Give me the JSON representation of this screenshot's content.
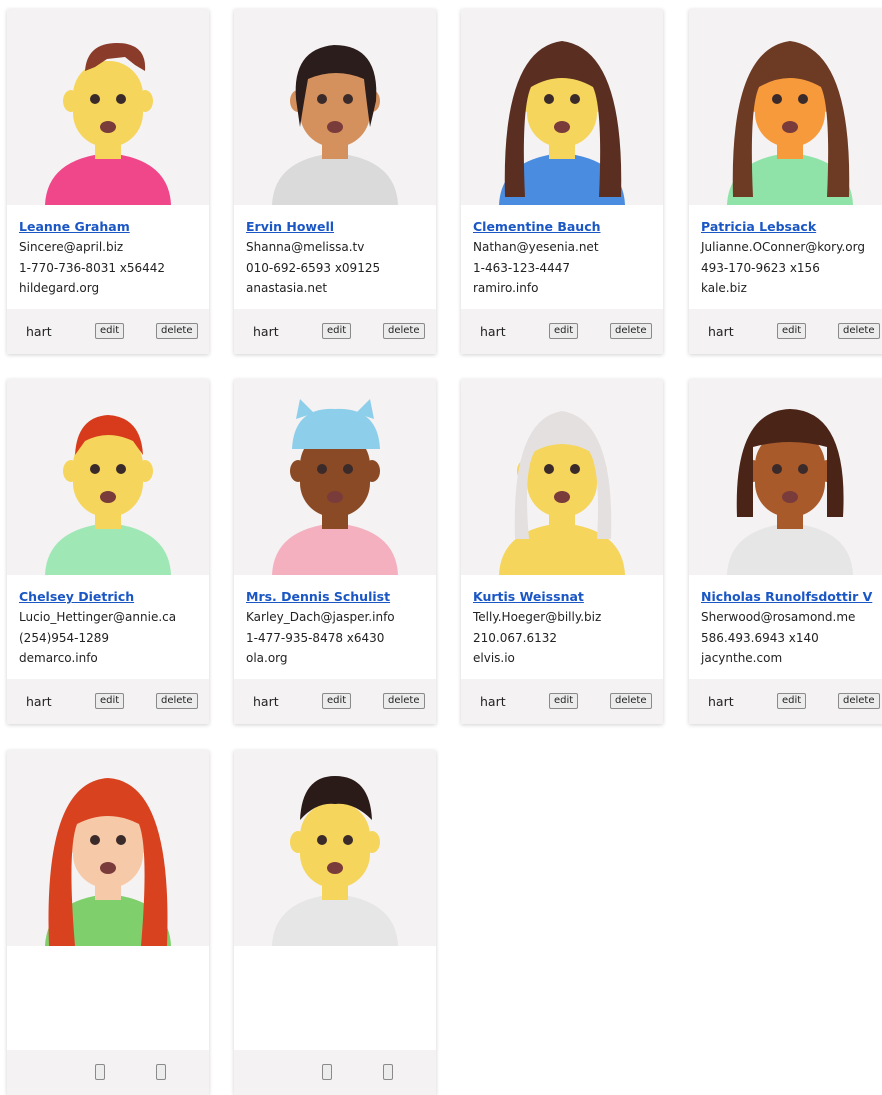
{
  "cards": [
    {
      "name": "Leanne Graham",
      "email": "Sincere@april.biz",
      "phone": "1-770-736-8031 x56442",
      "website": "hildegard.org",
      "action_label": "hart",
      "edit_label": "edit",
      "delete_label": "delete"
    },
    {
      "name": "Ervin Howell",
      "email": "Shanna@melissa.tv",
      "phone": "010-692-6593 x09125",
      "website": "anastasia.net",
      "action_label": "hart",
      "edit_label": "edit",
      "delete_label": "delete"
    },
    {
      "name": "Clementine Bauch",
      "email": "Nathan@yesenia.net",
      "phone": "1-463-123-4447",
      "website": "ramiro.info",
      "action_label": "hart",
      "edit_label": "edit",
      "delete_label": "delete"
    },
    {
      "name": "Patricia Lebsack",
      "email": "Julianne.OConner@kory.org",
      "phone": "493-170-9623 x156",
      "website": "kale.biz",
      "action_label": "hart",
      "edit_label": "edit",
      "delete_label": "delete"
    },
    {
      "name": "Chelsey Dietrich",
      "email": "Lucio_Hettinger@annie.ca",
      "phone": "(254)954-1289",
      "website": "demarco.info",
      "action_label": "hart",
      "edit_label": "edit",
      "delete_label": "delete"
    },
    {
      "name": "Mrs. Dennis Schulist",
      "email": "Karley_Dach@jasper.info",
      "phone": "1-477-935-8478 x6430",
      "website": "ola.org",
      "action_label": "hart",
      "edit_label": "edit",
      "delete_label": "delete"
    },
    {
      "name": "Kurtis Weissnat",
      "email": "Telly.Hoeger@billy.biz",
      "phone": "210.067.6132",
      "website": "elvis.io",
      "action_label": "hart",
      "edit_label": "edit",
      "delete_label": "delete"
    },
    {
      "name": "Nicholas Runolfsdottir V",
      "email": "Sherwood@rosamond.me",
      "phone": "586.493.6943 x140",
      "website": "jacynthe.com",
      "action_label": "hart",
      "edit_label": "edit",
      "delete_label": "delete"
    },
    {
      "name": "",
      "email": "",
      "phone": "",
      "website": "",
      "action_label": "",
      "edit_label": "",
      "delete_label": ""
    },
    {
      "name": "",
      "email": "",
      "phone": "",
      "website": "",
      "action_label": "",
      "edit_label": "",
      "delete_label": ""
    }
  ],
  "avatars": [
    {
      "icon": "avatar-dizzy-yellow-quiff-icon",
      "skin": "#f5d55b",
      "hair": "#8a3b2a",
      "shirt": "#f0478a"
    },
    {
      "icon": "avatar-calm-tan-bob-icon",
      "skin": "#d4915e",
      "hair": "#2b1d1b",
      "shirt": "#dadada"
    },
    {
      "icon": "avatar-winking-locs-icon",
      "skin": "#f5d55b",
      "hair": "#5a2f22",
      "shirt": "#4a8de0"
    },
    {
      "icon": "avatar-sunglasses-locs-icon",
      "skin": "#f79a3c",
      "hair": "#6d3a24",
      "shirt": "#8fe3a8"
    },
    {
      "icon": "avatar-redhead-rolling-eyes-icon",
      "skin": "#f5d55b",
      "hair": "#d83a1c",
      "shirt": "#9fe8b5"
    },
    {
      "icon": "avatar-cat-beanie-dizzy-icon",
      "skin": "#8a4a25",
      "hair": "#8dcfea",
      "shirt": "#f5b0bf"
    },
    {
      "icon": "avatar-white-hair-glasses-icon",
      "skin": "#f5d55b",
      "hair": "#e4e0e0",
      "shirt": "#f5d55b"
    },
    {
      "icon": "avatar-heart-eyes-bangs-icon",
      "skin": "#a85a2a",
      "hair": "#4a2417",
      "shirt": "#e6e6e6"
    },
    {
      "icon": "avatar-red-hair-mustache-icon",
      "skin": "#f6c9a8",
      "hair": "#d8421f",
      "shirt": "#7fcf6c"
    },
    {
      "icon": "avatar-dizzy-puffed-cheeks-icon",
      "skin": "#f5d55b",
      "hair": "#2a1b18",
      "shirt": "#e6e6e6"
    }
  ]
}
